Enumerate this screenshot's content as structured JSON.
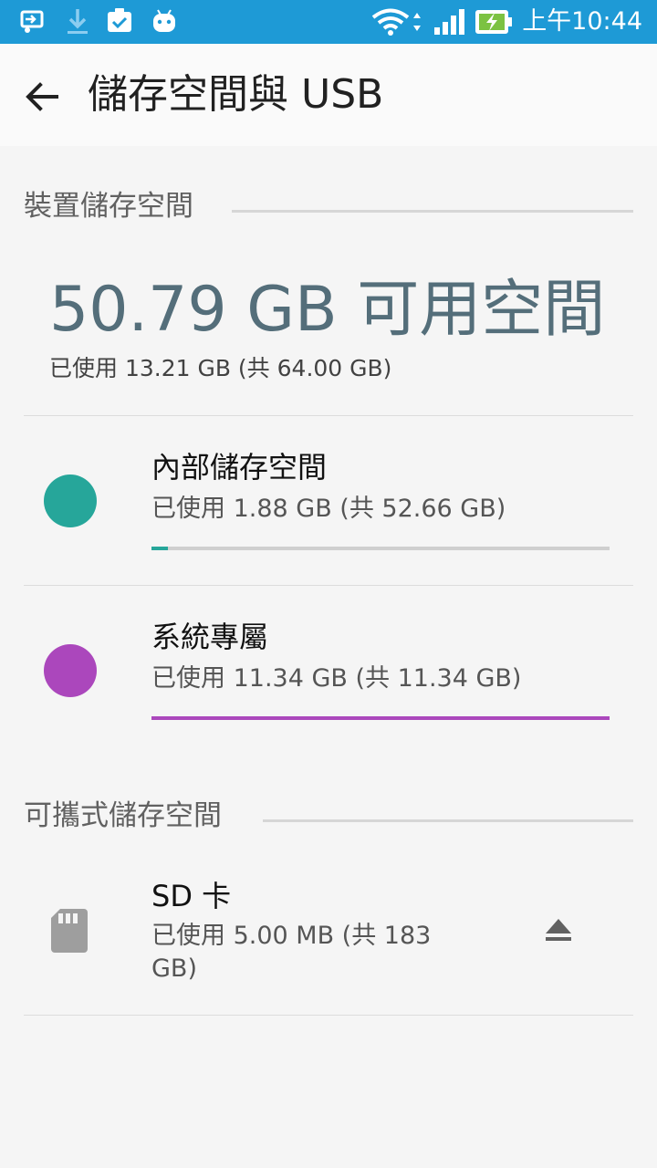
{
  "status_bar": {
    "time": "上午10:44",
    "icons": [
      "screen-cast-icon",
      "download-icon",
      "clipboard-check-icon",
      "android-icon",
      "wifi-icon",
      "cell-signal-icon",
      "battery-charging-icon"
    ],
    "background_color": "#1e9ad6"
  },
  "app_bar": {
    "title": "儲存空間與 USB",
    "back_icon": "back-arrow-icon"
  },
  "device_storage": {
    "header": "裝置儲存空間",
    "free_space": "50.79 GB 可用空間",
    "used_total": "已使用 13.21 GB (共 64.00 GB)",
    "volumes": [
      {
        "title": "內部儲存空間",
        "summary": "已使用 1.88 GB (共 52.66 GB)",
        "used_fraction": 0.036,
        "color": "#26a69a"
      },
      {
        "title": "系統專屬",
        "summary": "已使用 11.34 GB (共 11.34 GB)",
        "used_fraction": 1.0,
        "color": "#ab47bc"
      }
    ]
  },
  "portable_storage": {
    "header": "可攜式儲存空間",
    "sd_card": {
      "title": "SD 卡",
      "summary": "已使用 5.00 MB (共 183 GB)",
      "icon": "sd-card-icon",
      "eject_icon": "eject-icon"
    }
  }
}
